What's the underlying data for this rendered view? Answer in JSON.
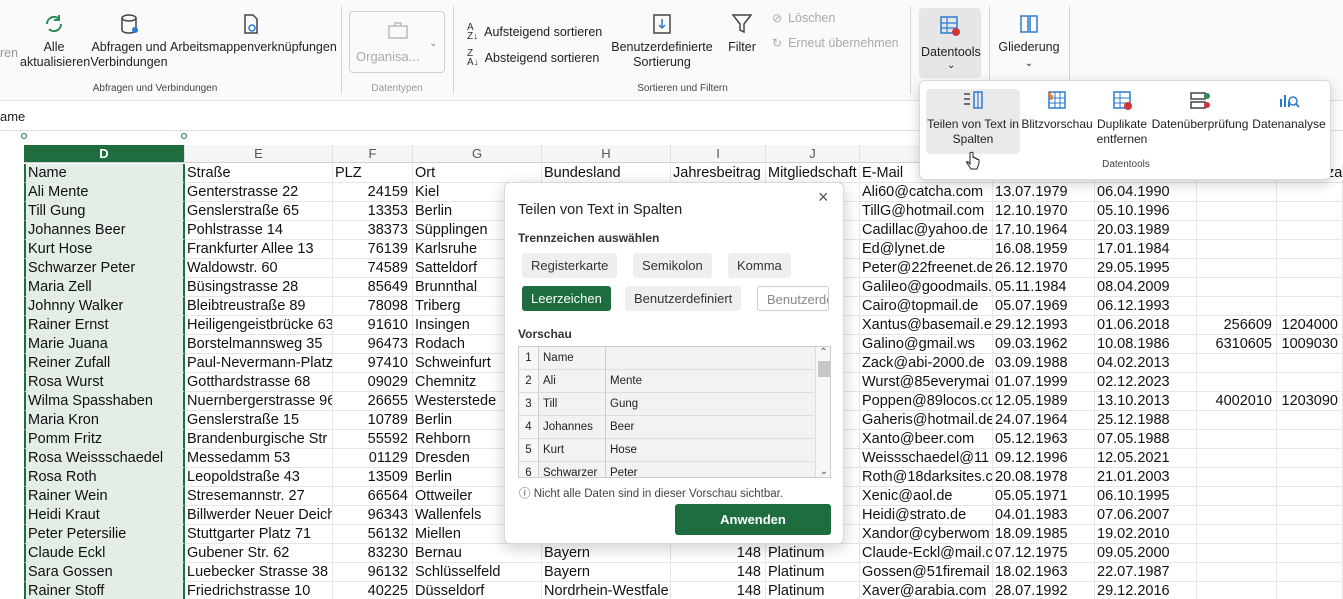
{
  "ribbon": {
    "truncated_left": "ren",
    "refresh_all": [
      "Alle",
      "aktualisieren"
    ],
    "queries_connections": [
      "Abfragen und",
      "Verbindungen"
    ],
    "workbook_links": "Arbeitsmappenverknüpfungen",
    "group_queries": "Abfragen und Verbindungen",
    "organisation": "Organisa...",
    "group_datatypes": "Datentypen",
    "sort_asc": "Aufsteigend sortieren",
    "sort_desc": "Absteigend sortieren",
    "custom_sort": [
      "Benutzerdefinierte",
      "Sortierung"
    ],
    "filter": "Filter",
    "clear": "Löschen",
    "reapply": "Erneut übernehmen",
    "group_sort_filter": "Sortieren und Filtern",
    "datentools": "Datentools",
    "gliederung": "Gliederung"
  },
  "datentools_panel": {
    "items": [
      [
        "Teilen von Text in",
        "Spalten"
      ],
      [
        "Blitzvorschau",
        ""
      ],
      [
        "Duplikate",
        "entfernen"
      ],
      [
        "Datenüberprüfung",
        ""
      ],
      [
        "Datenanalyse",
        ""
      ]
    ],
    "group_label": "Datentools"
  },
  "formula_bar": {
    "text": "ame"
  },
  "sheet": {
    "columns": [
      "D",
      "E",
      "F",
      "G",
      "H",
      "I",
      "J",
      ""
    ],
    "headers": [
      "Name",
      "Straße",
      "PLZ",
      "Ort",
      "Bundesland",
      "Jahresbeitrag",
      "Mitgliedschaft",
      "E-Mail"
    ],
    "right_edge_fragment": "za",
    "rows": [
      [
        "Ali Mente",
        "Genterstrasse 22",
        "24159",
        "Kiel",
        "",
        "",
        "",
        "Ali60@catcha.com",
        "13.07.1979",
        "06.04.1990",
        "",
        ""
      ],
      [
        "Till Gung",
        "Genslerstraße 65",
        "13353",
        "Berlin",
        "",
        "",
        "",
        "TillG@hotmail.com",
        "12.10.1970",
        "05.10.1996",
        "",
        ""
      ],
      [
        "Johannes Beer",
        "Pohlstrasse 14",
        "38373",
        "Süpplingen",
        "",
        "",
        "",
        "Cadillac@yahoo.de",
        "17.10.1964",
        "20.03.1989",
        "",
        ""
      ],
      [
        "Kurt Hose",
        "Frankfurter Allee 13",
        "76139",
        "Karlsruhe",
        "",
        "",
        "",
        "Ed@lynet.de",
        "16.08.1959",
        "17.01.1984",
        "",
        ""
      ],
      [
        "Schwarzer Peter",
        "Waldowstr. 60",
        "74589",
        "Satteldorf",
        "",
        "",
        "",
        "Peter@22freenet.de",
        "26.12.1970",
        "29.05.1995",
        "",
        ""
      ],
      [
        "Maria Zell",
        "Büsingstrasse 28",
        "85649",
        "Brunnthal",
        "",
        "",
        "",
        "Galileo@goodmails.",
        "05.11.1984",
        "08.04.2009",
        "",
        ""
      ],
      [
        "Johnny Walker",
        "Bleibtreustraße 89",
        "78098",
        "Triberg",
        "",
        "",
        "",
        "Cairo@topmail.de",
        "05.07.1969",
        "06.12.1993",
        "",
        ""
      ],
      [
        "Rainer Ernst",
        "Heiligengeistbrücke 63",
        "91610",
        "Insingen",
        "",
        "",
        "",
        "Xantus@basemail.e",
        "29.12.1993",
        "01.06.2018",
        "256609",
        "1204000"
      ],
      [
        "Marie Juana",
        "Borstelmannsweg 35",
        "96473",
        "Rodach",
        "",
        "",
        "",
        "Galino@gmail.ws",
        "09.03.1962",
        "10.08.1986",
        "6310605",
        "1009030"
      ],
      [
        "Reiner Zufall",
        "Paul-Nevermann-Platz",
        "97410",
        "Schweinfurt",
        "",
        "",
        "",
        "Zack@abi-2000.de",
        "03.09.1988",
        "04.02.2013",
        "",
        ""
      ],
      [
        "Rosa Wurst",
        "Gotthardstrasse 68",
        "09029",
        "Chemnitz",
        "",
        "",
        "",
        "Wurst@85everymai",
        "01.07.1999",
        "02.12.2023",
        "",
        ""
      ],
      [
        "Wilma Spasshaben",
        "Nuernbergerstrasse 96",
        "26655",
        "Westerstede",
        "",
        "",
        "",
        "Poppen@89locos.co",
        "12.05.1989",
        "13.10.2013",
        "4002010",
        "1203090"
      ],
      [
        "Maria Kron",
        "Genslerstraße 15",
        "10789",
        "Berlin",
        "",
        "",
        "",
        "Gaheris@hotmail.de",
        "24.07.1964",
        "25.12.1988",
        "",
        ""
      ],
      [
        "Pomm Fritz",
        "Brandenburgische Str",
        "55592",
        "Rehborn",
        "",
        "",
        "",
        "Xanto@beer.com",
        "05.12.1963",
        "07.05.1988",
        "",
        ""
      ],
      [
        "Rosa Weissschaedel",
        "Messedamm 53",
        "01129",
        "Dresden",
        "",
        "",
        "",
        "Weissschaedel@11",
        "09.12.1996",
        "12.05.2021",
        "",
        ""
      ],
      [
        "Rosa Roth",
        "Leopoldstraße 43",
        "13509",
        "Berlin",
        "",
        "",
        "",
        "Roth@18darksites.c",
        "20.08.1978",
        "21.01.2003",
        "",
        ""
      ],
      [
        "Rainer Wein",
        "Stresemannstr. 27",
        "66564",
        "Ottweiler",
        "",
        "",
        "",
        "Xenic@aol.de",
        "05.05.1971",
        "06.10.1995",
        "",
        ""
      ],
      [
        "Heidi Kraut",
        "Billwerder Neuer Deich",
        "96343",
        "Wallenfels",
        "",
        "",
        "",
        "Heidi@strato.de",
        "04.01.1983",
        "07.06.2007",
        "",
        ""
      ],
      [
        "Peter Petersilie",
        "Stuttgarter Platz 71",
        "56132",
        "Miellen",
        "",
        "",
        "",
        "Xandor@cyberwom",
        "18.09.1985",
        "19.02.2010",
        "",
        ""
      ],
      [
        "Claude Eckl",
        "Gubener Str. 62",
        "83230",
        "Bernau",
        "Bayern",
        "148",
        "Platinum",
        "Claude-Eckl@mail.c",
        "07.12.1975",
        "09.05.2000",
        "",
        ""
      ],
      [
        "Sara Gossen",
        "Luebecker Strasse 38",
        "96132",
        "Schlüsselfeld",
        "Bayern",
        "148",
        "Platinum",
        "Gossen@51firemail",
        "18.02.1963",
        "22.07.1987",
        "",
        ""
      ],
      [
        "Rainer Stoff",
        "Friedrichstrasse 10",
        "40225",
        "Düsseldorf",
        "Nordrhein-Westfale",
        "148",
        "Platinum",
        "Xaver@arabia.com",
        "28.07.1992",
        "29.12.2016",
        "",
        ""
      ]
    ]
  },
  "dialog": {
    "title": "Teilen von Text in Spalten",
    "delimiter_heading": "Trennzeichen auswählen",
    "options": [
      "Registerkarte",
      "Semikolon",
      "Komma",
      "Leerzeichen",
      "Benutzerdefiniert"
    ],
    "custom_placeholder": "Benutzerde",
    "preview_heading": "Vorschau",
    "preview_rows": [
      [
        "1",
        "Name",
        ""
      ],
      [
        "2",
        "Ali",
        "Mente"
      ],
      [
        "3",
        "Till",
        "Gung"
      ],
      [
        "4",
        "Johannes",
        "Beer"
      ],
      [
        "5",
        "Kurt",
        "Hose"
      ],
      [
        "6",
        "Schwarzer",
        "Peter"
      ]
    ],
    "note": "Nicht alle Daten sind in dieser Vorschau sichtbar.",
    "apply": "Anwenden",
    "close": "×"
  },
  "colors": {
    "accent": "#1e6d3f"
  }
}
